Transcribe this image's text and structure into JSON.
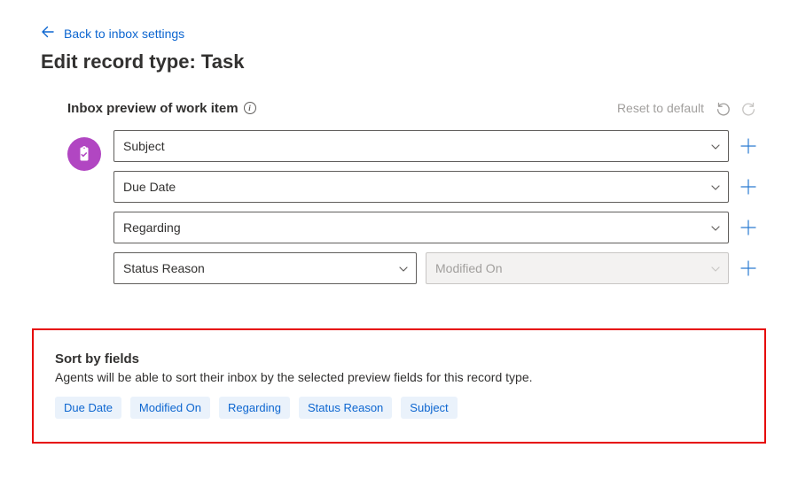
{
  "back_link": "Back to inbox settings",
  "page_title": "Edit record type: Task",
  "record_icon": "clipboard-check-icon",
  "preview": {
    "title": "Inbox preview of work item",
    "reset_label": "Reset to default",
    "rows": [
      {
        "fields": [
          {
            "value": "Subject",
            "disabled": false
          }
        ]
      },
      {
        "fields": [
          {
            "value": "Due Date",
            "disabled": false
          }
        ]
      },
      {
        "fields": [
          {
            "value": "Regarding",
            "disabled": false
          }
        ]
      },
      {
        "fields": [
          {
            "value": "Status Reason",
            "disabled": false
          },
          {
            "value": "Modified On",
            "disabled": true
          }
        ]
      }
    ]
  },
  "sort": {
    "title": "Sort by fields",
    "description": "Agents will be able to sort their inbox by the selected preview fields for this record type.",
    "chips": [
      "Due Date",
      "Modified On",
      "Regarding",
      "Status Reason",
      "Subject"
    ]
  }
}
